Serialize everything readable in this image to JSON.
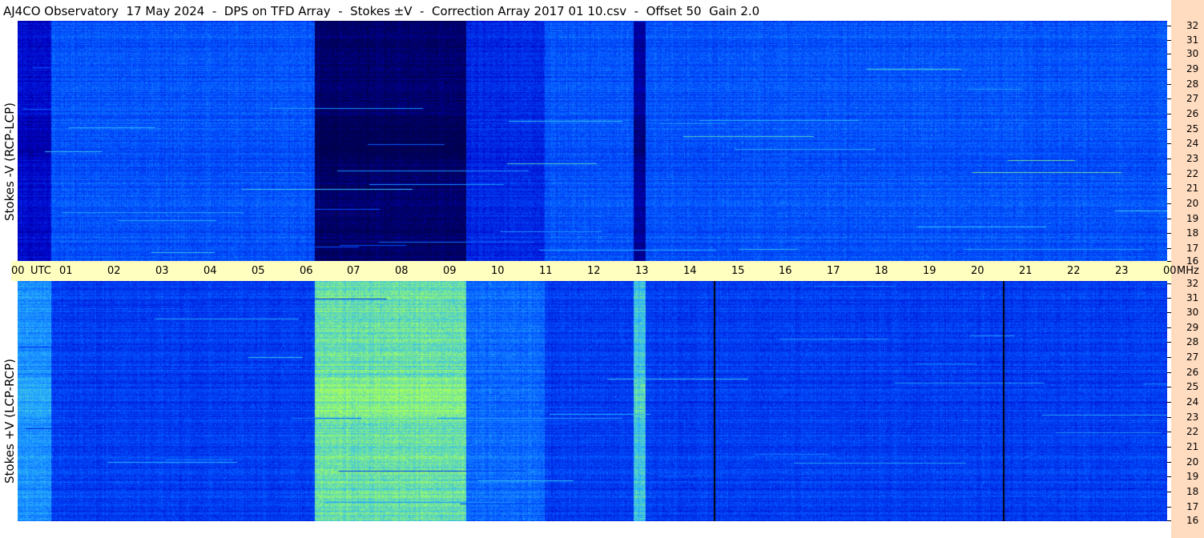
{
  "title": "AJ4CO Observatory  17 May 2024  -  DPS on TFD Array  -  Stokes ±V  -  Correction Array 2017 01 10.csv  -  Offset 50  Gain 2.0",
  "top_panel": {
    "ylabel": "Stokes -V (RCP-LCP)",
    "colormap": [
      "#000050",
      "#0000c8",
      "#0050ff",
      "#28b4ff",
      "#a0ff64",
      "#ffff00"
    ]
  },
  "bottom_panel": {
    "ylabel": "Stokes +V (LCP-RCP)",
    "colormap": [
      "#000050",
      "#0000c8",
      "#0050ff",
      "#28b4ff",
      "#a0ff64",
      "#ffff00"
    ]
  },
  "time_axis": {
    "labels": [
      "00",
      "UTC",
      "01",
      "02",
      "03",
      "04",
      "05",
      "06",
      "07",
      "08",
      "09",
      "10",
      "11",
      "12",
      "13",
      "14",
      "15",
      "16",
      "17",
      "18",
      "19",
      "20",
      "21",
      "22",
      "23",
      "00",
      "MHz"
    ]
  },
  "freq_axis": {
    "labels": [
      "32",
      "31",
      "30",
      "29",
      "28",
      "27",
      "26",
      "25",
      "24",
      "23",
      "22",
      "21",
      "20",
      "19",
      "18",
      "17",
      "16"
    ]
  },
  "colors": {
    "utc_bar": "#ffffc0",
    "freq_strip": "#ffdcc0"
  }
}
